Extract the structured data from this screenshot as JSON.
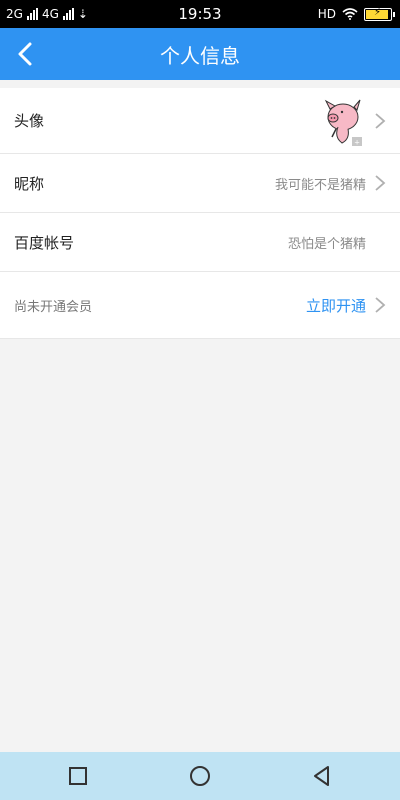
{
  "status_bar": {
    "net1": "2G",
    "net2": "4G",
    "time": "19:53",
    "hd": "HD"
  },
  "header": {
    "title": "个人信息",
    "back_icon": "chevron-left-icon"
  },
  "rows": [
    {
      "label": "头像",
      "value": "",
      "avatar": "pig-avatar"
    },
    {
      "label": "昵称",
      "value": "我可能不是猪精"
    },
    {
      "label": "百度帐号",
      "value": "恐怕是个猪精"
    },
    {
      "label": "尚未开通会员",
      "value": "立即开通"
    }
  ],
  "colors": {
    "accent": "#2f93f2",
    "nav_bg": "#bfe3f3"
  }
}
